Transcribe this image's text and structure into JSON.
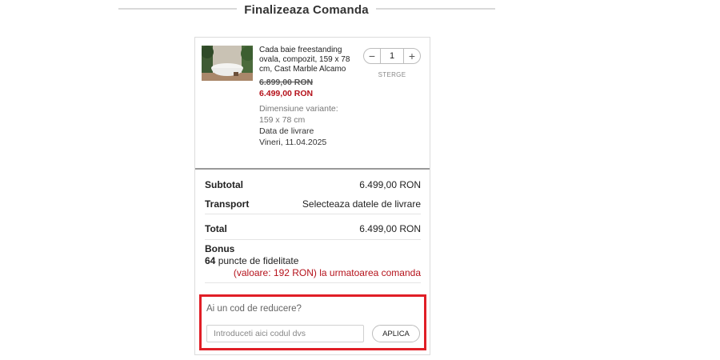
{
  "header": {
    "title": "Finalizeaza Comanda"
  },
  "cart": {
    "item": {
      "image_icon": "bathtub-photo",
      "name": "Cada baie freestanding ovala, compozit, 159 x 78 cm, Cast Marble Alcamo",
      "old_price": "6.899,00 RON",
      "new_price": "6.499,00 RON",
      "variant_label": "Dimensiune variante:",
      "variant_value": "159 x 78 cm",
      "delivery_label": "Data de livrare",
      "delivery_date": "Vineri, 11.04.2025",
      "quantity": "1",
      "minus": "−",
      "plus": "+",
      "remove_label": "STERGE"
    }
  },
  "summary": {
    "subtotal_label": "Subtotal",
    "subtotal_value": "6.499,00 RON",
    "transport_label": "Transport",
    "transport_value": "Selecteaza datele de livrare",
    "total_label": "Total",
    "total_value": "6.499,00 RON",
    "bonus_title": "Bonus",
    "bonus_points": "64",
    "bonus_points_text": "puncte de fidelitate",
    "bonus_value": "(valoare: 192 RON) la urmatoarea comanda"
  },
  "coupon": {
    "title": "Ai un cod de reducere?",
    "placeholder": "Introduceti aici codul dvs",
    "value": "",
    "apply_label": "APLICA"
  },
  "colors": {
    "accent_red": "#b5121b",
    "highlight_border": "#e01e26"
  }
}
